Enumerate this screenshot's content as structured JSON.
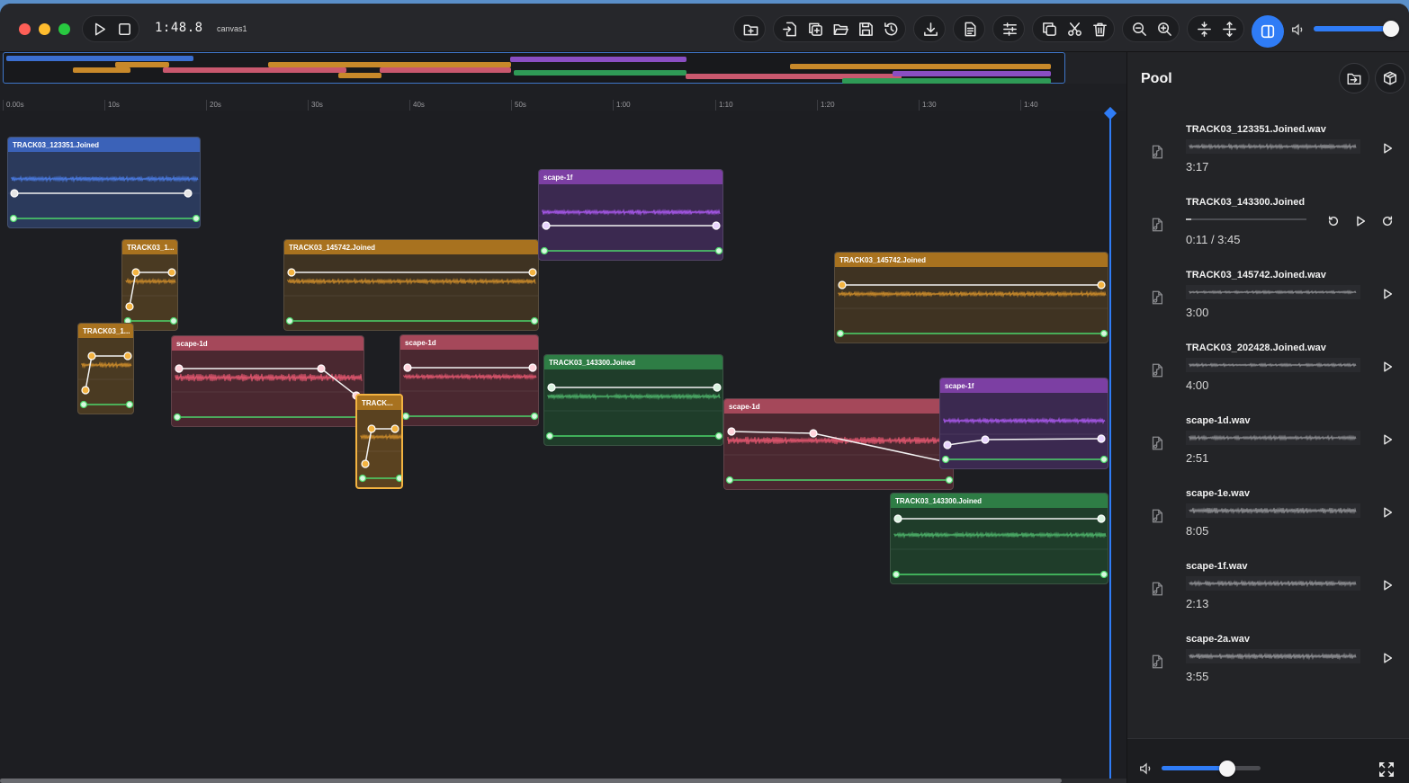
{
  "toolbar": {
    "time": "1:48.8",
    "canvas_name": "canvas1",
    "colors": {
      "accent": "#2f7cf6"
    },
    "master_volume": 0.9,
    "buttons": [
      "play-icon",
      "stop-icon",
      "add-clip-icon",
      "import-icon",
      "duplicate-file-icon",
      "open-folder-icon",
      "save-icon",
      "history-icon",
      "download-icon",
      "document-icon",
      "mixer-icon",
      "copy-icon",
      "cut-icon",
      "trash-icon",
      "zoom-out-icon",
      "zoom-in-icon",
      "collapse-icon",
      "expand-icon",
      "sidebar-icon",
      "speaker-icon"
    ]
  },
  "ruler": {
    "ticks": [
      "0.00s",
      "10s",
      "20s",
      "30s",
      "40s",
      "50s",
      "1:00",
      "1:10",
      "1:20",
      "1:30",
      "1:40"
    ]
  },
  "clips": [
    {
      "label": "TRACK03_123351.Joined",
      "color": "#3b62b8"
    },
    {
      "label": "TRACK03_1...",
      "color": "#a8721f"
    },
    {
      "label": "TRACK03_1...",
      "color": "#a8721f"
    },
    {
      "label": "TRACK03_145742.Joined",
      "color": "#a8721f"
    },
    {
      "label": "scape-1d",
      "color": "#a5485a"
    },
    {
      "label": "scape-1d",
      "color": "#a5485a"
    },
    {
      "label": "TRACK...",
      "color": "#a8721f"
    },
    {
      "label": "scape-1f",
      "color": "#7c3fa3"
    },
    {
      "label": "TRACK03_143300.Joined",
      "color": "#2e7d45"
    },
    {
      "label": "scape-1d",
      "color": "#a5485a"
    },
    {
      "label": "TRACK03_145742.Joined",
      "color": "#a8721f"
    },
    {
      "label": "scape-1f",
      "color": "#7c3fa3"
    },
    {
      "label": "TRACK03_143300.Joined",
      "color": "#2e7d45"
    }
  ],
  "pool": {
    "title": "Pool",
    "items": [
      {
        "name": "TRACK03_123351.Joined.wav",
        "duration": "3:17"
      },
      {
        "name": "TRACK03_143300.Joined",
        "duration": "0:11 / 3:45",
        "playing": true
      },
      {
        "name": "TRACK03_145742.Joined.wav",
        "duration": "3:00"
      },
      {
        "name": "TRACK03_202428.Joined.wav",
        "duration": "4:00"
      },
      {
        "name": "scape-1d.wav",
        "duration": "2:51"
      },
      {
        "name": "scape-1e.wav",
        "duration": "8:05"
      },
      {
        "name": "scape-1f.wav",
        "duration": "2:13"
      },
      {
        "name": "scape-2a.wav",
        "duration": "3:55"
      }
    ],
    "volume": 0.66
  }
}
